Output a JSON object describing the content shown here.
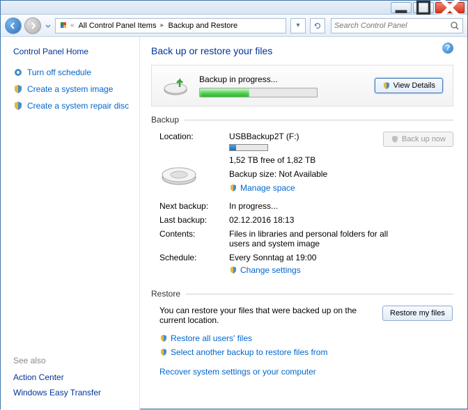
{
  "breadcrumb": {
    "item1": "All Control Panel Items",
    "item2": "Backup and Restore"
  },
  "search": {
    "placeholder": "Search Control Panel"
  },
  "sidebar": {
    "home": "Control Panel Home",
    "links": {
      "turn_off": "Turn off schedule",
      "create_image": "Create a system image",
      "create_disc": "Create a system repair disc"
    },
    "see_also": "See also",
    "action_center": "Action Center",
    "easy_transfer": "Windows Easy Transfer"
  },
  "main": {
    "title": "Back up or restore your files",
    "progress_label": "Backup in progress...",
    "view_details": "View Details",
    "backup_header": "Backup",
    "back_up_now": "Back up now",
    "location_label": "Location:",
    "location_value": "USBBackup2T (F:)",
    "free_space": "1,52 TB free of 1,82 TB",
    "backup_size": "Backup size: Not Available",
    "manage_space": "Manage space",
    "next_backup_label": "Next backup:",
    "next_backup_value": "In progress...",
    "last_backup_label": "Last backup:",
    "last_backup_value": "02.12.2016 18:13",
    "contents_label": "Contents:",
    "contents_value": "Files in libraries and personal folders for all users and system image",
    "schedule_label": "Schedule:",
    "schedule_value": "Every Sonntag at 19:00",
    "change_settings": "Change settings",
    "restore_header": "Restore",
    "restore_text": "You can restore your files that were backed up on the current location.",
    "restore_my_files": "Restore my files",
    "restore_all": "Restore all users' files",
    "select_another": "Select another backup to restore files from",
    "recover": "Recover system settings or your computer"
  },
  "progress_percent": 42,
  "disk_used_percent": 16
}
